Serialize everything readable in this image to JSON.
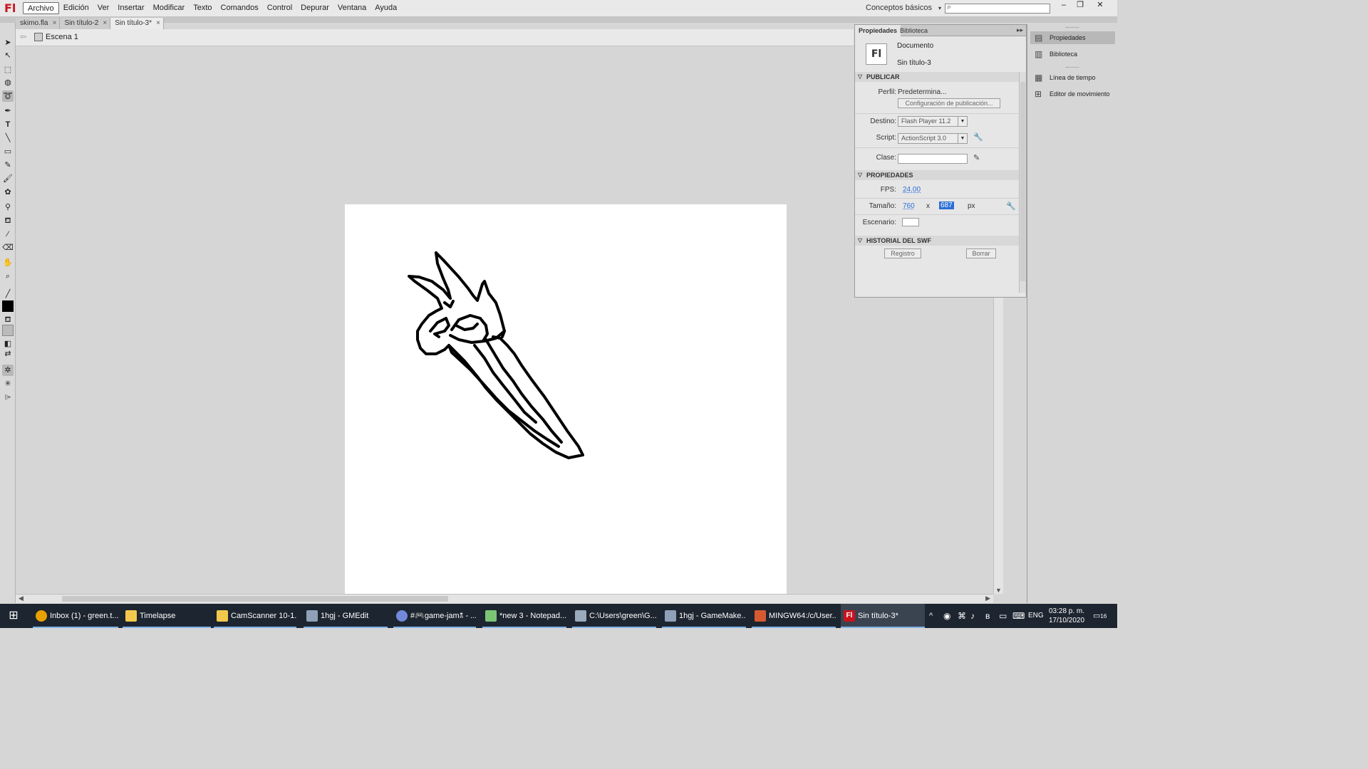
{
  "app": {
    "logo": "Fl"
  },
  "menubar": {
    "items": [
      "Archivo",
      "Edición",
      "Ver",
      "Insertar",
      "Modificar",
      "Texto",
      "Comandos",
      "Control",
      "Depurar",
      "Ventana",
      "Ayuda"
    ],
    "active": "Archivo",
    "workspace": "Conceptos básicos",
    "workspace_arrow": "▾",
    "search_placeholder": ""
  },
  "window_controls": {
    "minimize": "–",
    "restore": "❐",
    "close": "✕"
  },
  "doc_tabs": [
    {
      "label": "skimo.fla",
      "close": "×"
    },
    {
      "label": "Sin título-2",
      "close": "×"
    },
    {
      "label": "Sin título-3*",
      "close": "×",
      "active": true
    }
  ],
  "scene": {
    "back": "⇦",
    "name": "Escena 1"
  },
  "properties_panel": {
    "tabs": [
      "Propiedades",
      "Biblioteca"
    ],
    "menu": "▸▸",
    "doc_icon": "Fl",
    "doc_type": "Documento",
    "doc_name": "Sin título-3",
    "publish": {
      "header": "PUBLICAR",
      "perfil_label": "Perfil:",
      "perfil_value": "Predetermina...",
      "config_button": "Configuración de publicación...",
      "destino_label": "Destino:",
      "destino_value": "Flash Player 11.2",
      "script_label": "Script:",
      "script_value": "ActionScript 3.0",
      "clase_label": "Clase:",
      "clase_value": ""
    },
    "props": {
      "header": "PROPIEDADES",
      "fps_label": "FPS:",
      "fps_value": "24.00",
      "size_label": "Tamaño:",
      "width": "760",
      "x": "x",
      "height": "687",
      "unit": "px",
      "stage_label": "Escenario:",
      "stage_color": "#ffffff"
    },
    "swf_history": {
      "header": "HISTORIAL DEL SWF",
      "log_button": "Registro",
      "clear_button": "Borrar"
    }
  },
  "dock": {
    "items": [
      {
        "label": "Propiedades",
        "icon": "properties-icon",
        "active": true
      },
      {
        "label": "Biblioteca",
        "icon": "library-icon"
      },
      {
        "label": "Línea de tiempo",
        "icon": "timeline-icon"
      },
      {
        "label": "Editor de movimiento",
        "icon": "motion-editor-icon"
      }
    ]
  },
  "taskbar": {
    "items": [
      {
        "label": "Inbox (1) - green.t...",
        "icon": "chrome-icon",
        "color": "#e8a100"
      },
      {
        "label": "Timelapse",
        "icon": "folder-icon",
        "color": "#f2c94c"
      },
      {
        "label": "CamScanner 10-1...",
        "icon": "folder-icon",
        "color": "#f2c94c"
      },
      {
        "label": "1hgj - GMEdit",
        "icon": "gmedit-icon",
        "color": "#8fa0b8"
      },
      {
        "label": "#🎮game-jam🕱 - ...",
        "icon": "discord-icon",
        "color": "#7289da"
      },
      {
        "label": "*new 3 - Notepad...",
        "icon": "notepad-icon",
        "color": "#7cc576"
      },
      {
        "label": "C:\\Users\\green\\G...",
        "icon": "explorer-icon",
        "color": "#9ab"
      },
      {
        "label": "1hgj - GameMake...",
        "icon": "gamemaker-icon",
        "color": "#8fa0b8"
      },
      {
        "label": "MINGW64:/c/User...",
        "icon": "git-icon",
        "color": "#d65a31"
      },
      {
        "label": "Sin título-3*",
        "icon": "flash-icon",
        "color": "#c8141e",
        "active": true
      }
    ],
    "tray": {
      "chevron": "^",
      "lang": "ENG",
      "time": "03:28 p. m.",
      "date": "17/10/2020",
      "notifications": "16"
    }
  }
}
